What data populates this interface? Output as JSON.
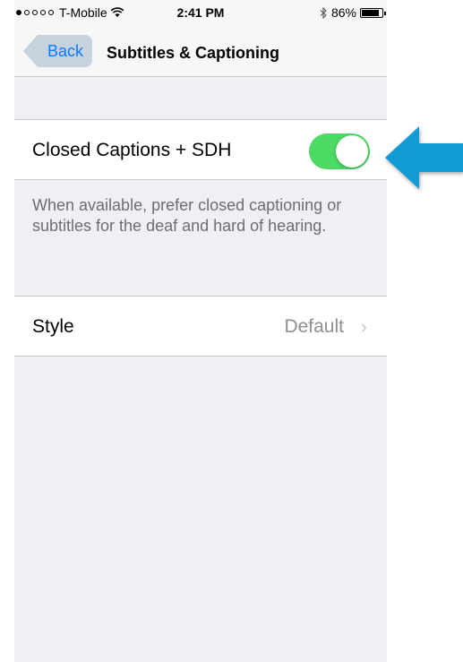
{
  "status_bar": {
    "signal_dots": [
      true,
      false,
      false,
      false,
      false
    ],
    "carrier": "T-Mobile",
    "time": "2:41 PM",
    "battery_percent": "86%",
    "battery_level": 0.86,
    "icons": [
      "wifi-icon",
      "bluetooth-icon",
      "battery-icon"
    ]
  },
  "nav": {
    "back_label": "Back",
    "title": "Subtitles & Captioning"
  },
  "settings": {
    "closed_captions": {
      "label": "Closed Captions + SDH",
      "enabled": true
    },
    "footer": "When available, prefer closed captioning or subtitles for the deaf and hard of hearing.",
    "style": {
      "label": "Style",
      "value": "Default",
      "chevron": "›"
    }
  },
  "annotation": {
    "icon": "arrow-left-icon",
    "color": "#139bd5"
  },
  "colors": {
    "accent": "#0a7aff",
    "toggle_on": "#4cd964",
    "background": "#efeff4"
  }
}
